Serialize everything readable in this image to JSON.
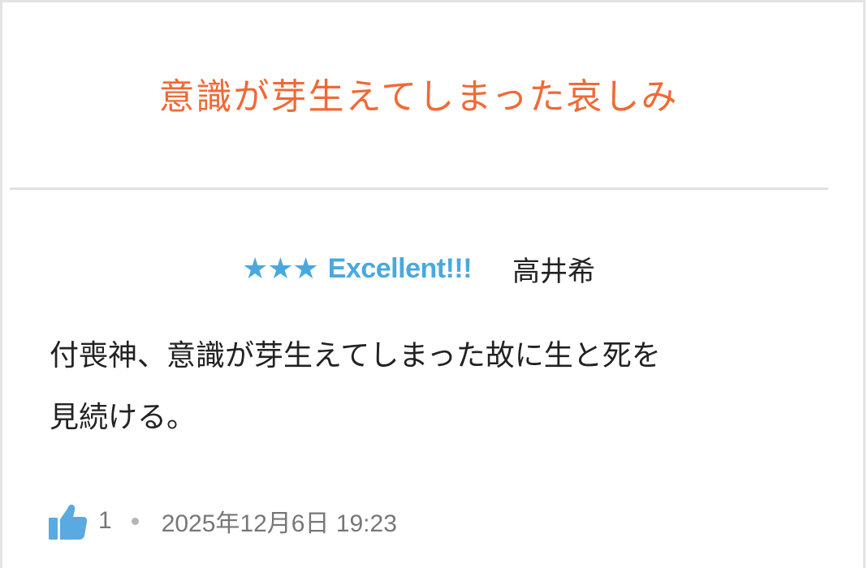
{
  "review": {
    "title": "意識が芽生えてしまった哀しみ",
    "rating": {
      "stars": "★★★",
      "label": "Excellent!!!"
    },
    "reviewer": "高井希",
    "body_line1": "付喪神、意識が芽生えてしまった故に生と死を",
    "body_line2": "見続ける。",
    "likes": "1",
    "timestamp": "2025年12月6日 19:23"
  },
  "icons": {
    "like": "thumbs-up-icon",
    "separator": "dot"
  },
  "colors": {
    "title": "#f06a36",
    "rating": "#4aa8e0",
    "thumb": "#5aa9e0",
    "meta": "#777777",
    "text": "#222222",
    "divider": "#e1e1e1"
  }
}
